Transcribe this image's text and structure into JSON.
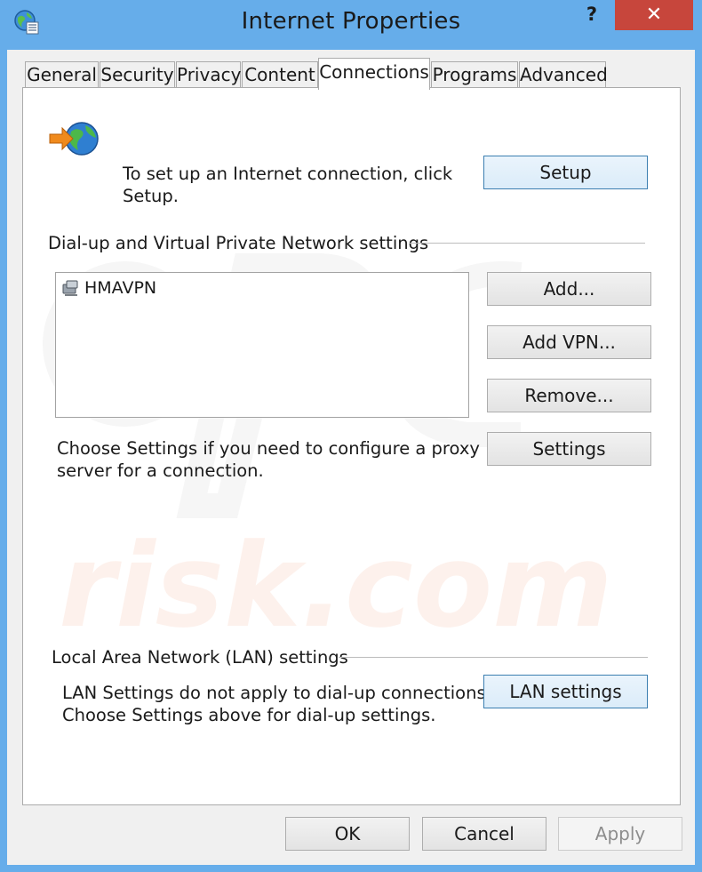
{
  "window": {
    "title": "Internet Properties",
    "help_label": "?",
    "close_label": "✕"
  },
  "tabs": [
    {
      "label": "General"
    },
    {
      "label": "Security"
    },
    {
      "label": "Privacy"
    },
    {
      "label": "Content"
    },
    {
      "label": "Connections",
      "active": true
    },
    {
      "label": "Programs"
    },
    {
      "label": "Advanced"
    }
  ],
  "setup": {
    "text_line1": "To set up an Internet connection, click",
    "text_line2": "Setup.",
    "button": "Setup",
    "icon": "globe-arrow-icon"
  },
  "dialup": {
    "heading": "Dial-up and Virtual Private Network settings",
    "connections": [
      {
        "name": "HMAVPN",
        "icon": "vpn-connection-icon"
      }
    ],
    "add_button": "Add...",
    "add_vpn_button": "Add VPN...",
    "remove_button": "Remove...",
    "settings_button": "Settings",
    "proxy_text_line1": "Choose Settings if you need to configure a proxy",
    "proxy_text_line2": "server for a connection."
  },
  "lan": {
    "heading": "Local Area Network (LAN) settings",
    "text_line1": "LAN Settings do not apply to dial-up connections.",
    "text_line2": "Choose Settings above for dial-up settings.",
    "button": "LAN settings"
  },
  "footer": {
    "ok": "OK",
    "cancel": "Cancel",
    "apply": "Apply"
  },
  "watermark": {
    "text": "risk.com"
  },
  "colors": {
    "titlebar": "#66adea",
    "close": "#c7463c",
    "focus_border": "#3c7fb1"
  }
}
